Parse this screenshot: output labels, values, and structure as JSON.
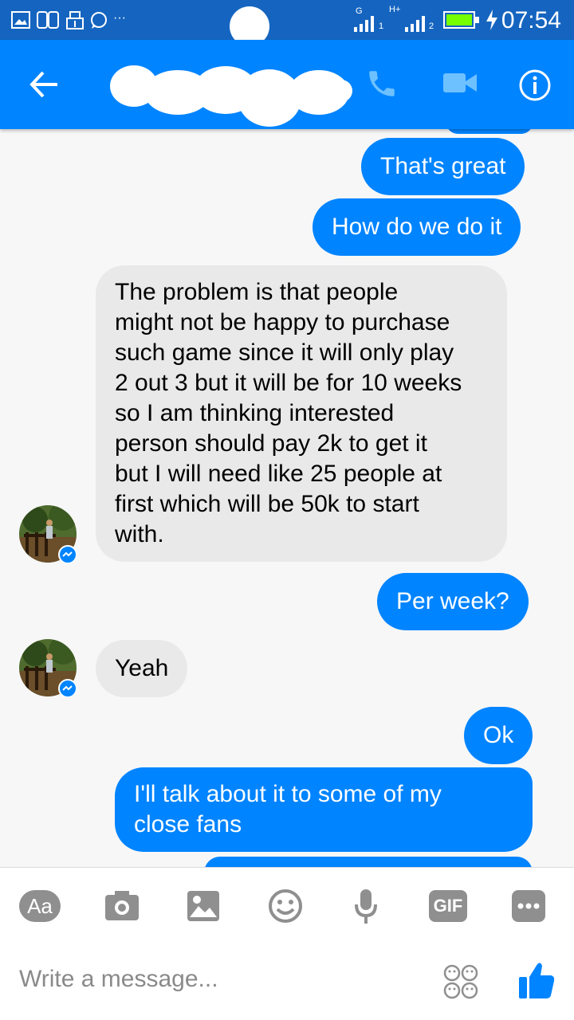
{
  "status_bar": {
    "time": "07:54",
    "notification_icons": [
      "picture-icon",
      "voicemail-icon",
      "usb-icon",
      "whatsapp-icon",
      "more-dots-icon"
    ],
    "signal1_label": "G",
    "signal1_sim": "1",
    "signal2_label": "H+",
    "signal2_sim": "2"
  },
  "header": {
    "contact_name_redacted": true,
    "back_icon": "back-arrow-icon",
    "call_icon": "phone-icon",
    "video_icon": "video-camera-icon",
    "info_icon": "info-icon"
  },
  "messages": [
    {
      "side": "out",
      "text": "That's great"
    },
    {
      "side": "out",
      "text": "How do we do it"
    },
    {
      "side": "in",
      "text": "The problem is that people\nmight not be happy to purchase\nsuch game since it will only play\n2 out 3 but it will be for 10 weeks\nso I am thinking interested\nperson should pay 2k to get it\nbut I will need like 25 people at\nfirst which will be 50k to start\nwith."
    },
    {
      "side": "out",
      "text": "Per week?"
    },
    {
      "side": "in",
      "text": "Yeah"
    },
    {
      "side": "out",
      "text": "Ok"
    },
    {
      "side": "out",
      "text": "I'll talk about it to some of my\nclose fans"
    }
  ],
  "composer": {
    "placeholder": "Write a message...",
    "aa_label": "Aa",
    "gif_label": "GIF",
    "tools": [
      "text-format-icon",
      "camera-icon",
      "gallery-icon",
      "emoji-icon",
      "microphone-icon",
      "gif-icon",
      "more-icon"
    ],
    "like_icon": "thumbs-up-icon",
    "sticker_icon": "sticker-faces-icon"
  },
  "colors": {
    "messenger_blue": "#0084ff",
    "status_bar": "#1565c0",
    "incoming_bubble": "#e9e9e9",
    "background": "#f7f7f7"
  }
}
